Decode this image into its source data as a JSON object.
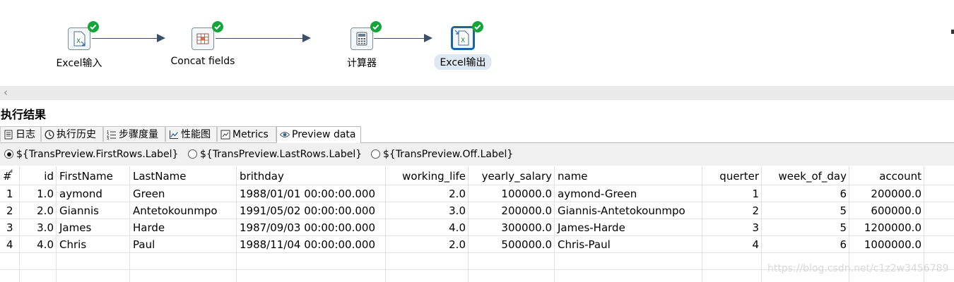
{
  "steps": [
    {
      "label": "Excel输入",
      "icon": "excel-input-icon"
    },
    {
      "label": "Concat fields",
      "icon": "concat-fields-icon"
    },
    {
      "label": "计算器",
      "icon": "calculator-icon"
    },
    {
      "label": "Excel输出",
      "icon": "excel-output-icon",
      "selected": true
    }
  ],
  "results_title": "执行结果",
  "tabs": [
    {
      "label": "日志",
      "icon": "log-icon"
    },
    {
      "label": "执行历史",
      "icon": "history-icon"
    },
    {
      "label": "步骤度量",
      "icon": "step-metrics-icon"
    },
    {
      "label": "性能图",
      "icon": "performance-chart-icon"
    },
    {
      "label": "Metrics",
      "icon": "metrics-icon"
    },
    {
      "label": "Preview data",
      "icon": "eye-icon",
      "active": true
    }
  ],
  "preview_options": [
    {
      "label": "${TransPreview.FirstRows.Label}",
      "selected": true
    },
    {
      "label": "${TransPreview.LastRows.Label}",
      "selected": false
    },
    {
      "label": "${TransPreview.Off.Label}",
      "selected": false
    }
  ],
  "table": {
    "columns": [
      "#",
      "id",
      "FirstName",
      "LastName",
      "brithday",
      "working_life",
      "yearly_salary",
      "name",
      "querter",
      "week_of_day",
      "account"
    ],
    "rows": [
      [
        "1",
        "1.0",
        "aymond",
        "Green",
        "1988/01/01 00:00:00.000",
        "2.0",
        "100000.0",
        "aymond-Green",
        "1",
        "6",
        "200000.0"
      ],
      [
        "2",
        "2.0",
        "Giannis",
        "Antetokounmpo",
        "1991/05/02 00:00:00.000",
        "3.0",
        "200000.0",
        "Giannis-Antetokounmpo",
        "2",
        "5",
        "600000.0"
      ],
      [
        "3",
        "3.0",
        "James",
        "Harde",
        "1987/09/03 00:00:00.000",
        "4.0",
        "300000.0",
        "James-Harde",
        "3",
        "5",
        "1200000.0"
      ],
      [
        "4",
        "4.0",
        "Chris",
        "Paul",
        "1988/11/04 00:00:00.000",
        "2.0",
        "500000.0",
        "Chris-Paul",
        "4",
        "6",
        "1000000.0"
      ]
    ]
  },
  "watermark": "https://blog.csdn.net/c1z2w3456789",
  "colors": {
    "accent": "#1f63a5",
    "ok": "#14a53a",
    "hop": "#3a5068"
  }
}
